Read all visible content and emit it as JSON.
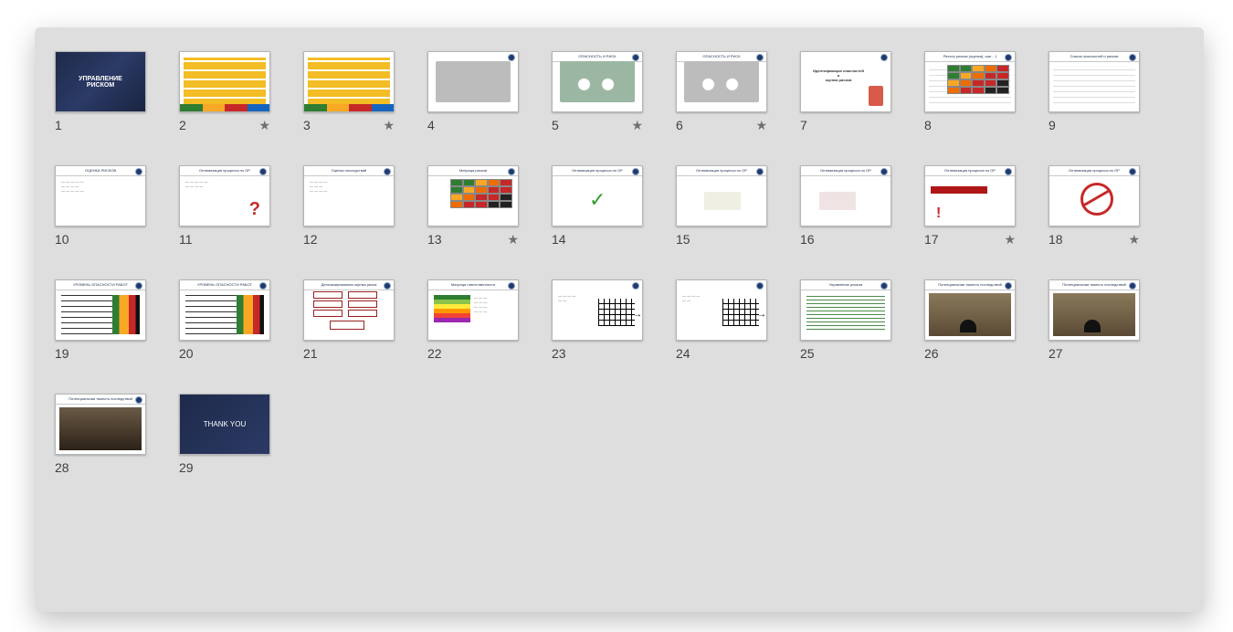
{
  "slides": [
    {
      "n": "1",
      "star": false,
      "kind": "title",
      "title1": "УПРАВЛЕНИЕ",
      "title2": "РИСКОМ"
    },
    {
      "n": "2",
      "star": true,
      "kind": "orgchart"
    },
    {
      "n": "3",
      "star": true,
      "kind": "orgchart"
    },
    {
      "n": "4",
      "star": false,
      "kind": "room"
    },
    {
      "n": "5",
      "star": true,
      "kind": "chairs",
      "head": "ОПАСНОСТЬ И РИСК"
    },
    {
      "n": "6",
      "star": true,
      "kind": "chairs-gray",
      "head": "ОПАСНОСТЬ И РИСК"
    },
    {
      "n": "7",
      "star": false,
      "kind": "ident",
      "line1": "Идентификация опасностей",
      "line2": "и",
      "line3": "оценка рисков"
    },
    {
      "n": "8",
      "star": false,
      "kind": "register",
      "head": "Реестр рисков (оценка), шаг - 1"
    },
    {
      "n": "9",
      "star": false,
      "kind": "list",
      "head": "Список опасностей и рисков"
    },
    {
      "n": "10",
      "star": false,
      "kind": "assess",
      "head": "ОЦЕНКА РИСКОВ"
    },
    {
      "n": "11",
      "star": false,
      "kind": "question",
      "head": "Оптимизация процесса по ОР"
    },
    {
      "n": "12",
      "star": false,
      "kind": "conseq",
      "head": "Оценка последствий"
    },
    {
      "n": "13",
      "star": true,
      "kind": "matrix",
      "head": "Матрица рисков"
    },
    {
      "n": "14",
      "star": false,
      "kind": "check",
      "head": "Оптимизация процесса по ОР"
    },
    {
      "n": "15",
      "star": false,
      "kind": "pale",
      "head": "Оптимизация процесса по ОР"
    },
    {
      "n": "16",
      "star": false,
      "kind": "pale2",
      "head": "Оптимизация процесса по ОР"
    },
    {
      "n": "17",
      "star": true,
      "kind": "redbar",
      "head": "Оптимизация процесса по ОР"
    },
    {
      "n": "18",
      "star": true,
      "kind": "nosign",
      "head": "Оптимизация процесса по ОР"
    },
    {
      "n": "19",
      "star": false,
      "kind": "bars",
      "head": "УРОВЕНЬ ОПАСНОСТИ РАБОТ"
    },
    {
      "n": "20",
      "star": false,
      "kind": "bars",
      "head": "УРОВЕНЬ ОПАСНОСТИ РАБОТ"
    },
    {
      "n": "21",
      "star": false,
      "kind": "flow",
      "head": "Детализированная оценка риска"
    },
    {
      "n": "22",
      "star": false,
      "kind": "rainbow",
      "head": "Матрица ответственности"
    },
    {
      "n": "23",
      "star": false,
      "kind": "griddemo",
      "head": ""
    },
    {
      "n": "24",
      "star": false,
      "kind": "griddemo",
      "head": ""
    },
    {
      "n": "25",
      "star": false,
      "kind": "textlines",
      "head": "Управление риском"
    },
    {
      "n": "26",
      "star": false,
      "kind": "tunnel",
      "head": "Потенциальная тяжесть последствий"
    },
    {
      "n": "27",
      "star": false,
      "kind": "tunnel",
      "head": "Потенциальная тяжесть последствий"
    },
    {
      "n": "28",
      "star": false,
      "kind": "pit",
      "head": "Потенциальная тяжесть последствий"
    },
    {
      "n": "29",
      "star": false,
      "kind": "thanks",
      "text": "THANK YOU"
    }
  ],
  "star_glyph": "★"
}
